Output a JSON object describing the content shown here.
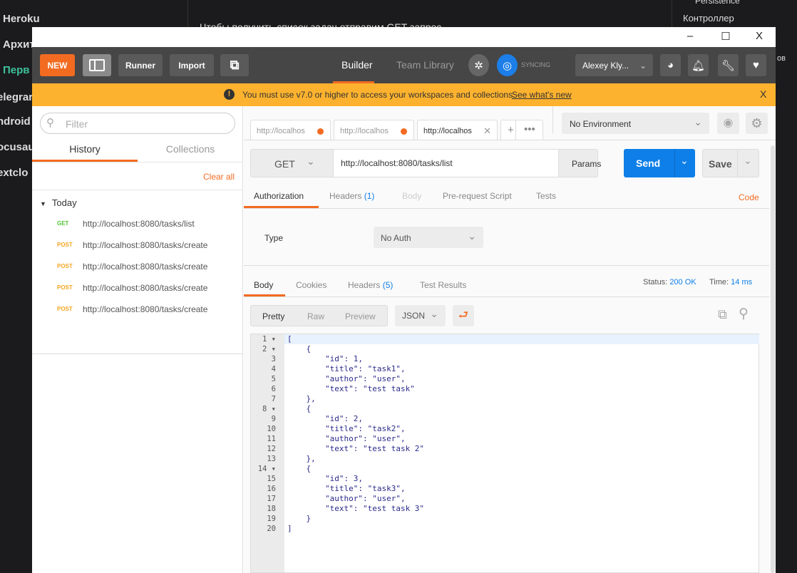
{
  "background": {
    "left_items": [
      "Heroku",
      "Архит",
      "Перв",
      "elegrar",
      "ndroid",
      "ocusau",
      "extclo"
    ],
    "mid_text": "Чтобы получить список задач отправим GET запрос",
    "right_items": [
      "Persistence",
      "Контроллер",
      "ов"
    ]
  },
  "window": {
    "minimize": "–",
    "maximize": "☐",
    "close": "X"
  },
  "toolbar": {
    "new": "NEW",
    "runner": "Runner",
    "import": "Import",
    "builder": "Builder",
    "team_library": "Team Library",
    "syncing": "SYNCING",
    "user": "Alexey Kly...",
    "accent": "#f26b21"
  },
  "banner": {
    "message": "You must use v7.0 or higher to access your workspaces and collections.",
    "link": "See what's new",
    "close": "X"
  },
  "sidebar": {
    "filter_placeholder": "Filter",
    "tabs": [
      "History",
      "Collections"
    ],
    "clear_all": "Clear all",
    "group": "Today",
    "items": [
      {
        "method": "GET",
        "url": "http://localhost:8080/tasks/list"
      },
      {
        "method": "POST",
        "url": "http://localhost:8080/tasks/create"
      },
      {
        "method": "POST",
        "url": "http://localhost:8080/tasks/create"
      },
      {
        "method": "POST",
        "url": "http://localhost:8080/tasks/create"
      },
      {
        "method": "POST",
        "url": "http://localhost:8080/tasks/create"
      }
    ]
  },
  "tabs": [
    "http://localhos",
    "http://localhos",
    "http://localhos"
  ],
  "environment": "No Environment",
  "request": {
    "method": "GET",
    "url": "http://localhost:8080/tasks/list",
    "params": "Params",
    "send": "Send",
    "save": "Save"
  },
  "req_tabs": {
    "authorization": "Authorization",
    "headers": "Headers",
    "headers_count": "(1)",
    "body": "Body",
    "prerequest": "Pre-request Script",
    "tests": "Tests",
    "code": "Code"
  },
  "auth": {
    "type_label": "Type",
    "type_value": "No Auth"
  },
  "resp_tabs": {
    "body": "Body",
    "cookies": "Cookies",
    "headers": "Headers",
    "headers_count": "(5)",
    "test_results": "Test Results",
    "status_label": "Status:",
    "status": "200 OK",
    "time_label": "Time:",
    "time": "14 ms"
  },
  "view": {
    "pretty": "Pretty",
    "raw": "Raw",
    "preview": "Preview",
    "format": "JSON"
  },
  "code_lines": [
    "[",
    "    {",
    "        \"id\": 1,",
    "        \"title\": \"task1\",",
    "        \"author\": \"user\",",
    "        \"text\": \"test task\"",
    "    },",
    "    {",
    "        \"id\": 2,",
    "        \"title\": \"task2\",",
    "        \"author\": \"user\",",
    "        \"text\": \"test task 2\"",
    "    },",
    "    {",
    "        \"id\": 3,",
    "        \"title\": \"task3\",",
    "        \"author\": \"user\",",
    "        \"text\": \"test task 3\"",
    "    }",
    "]"
  ]
}
